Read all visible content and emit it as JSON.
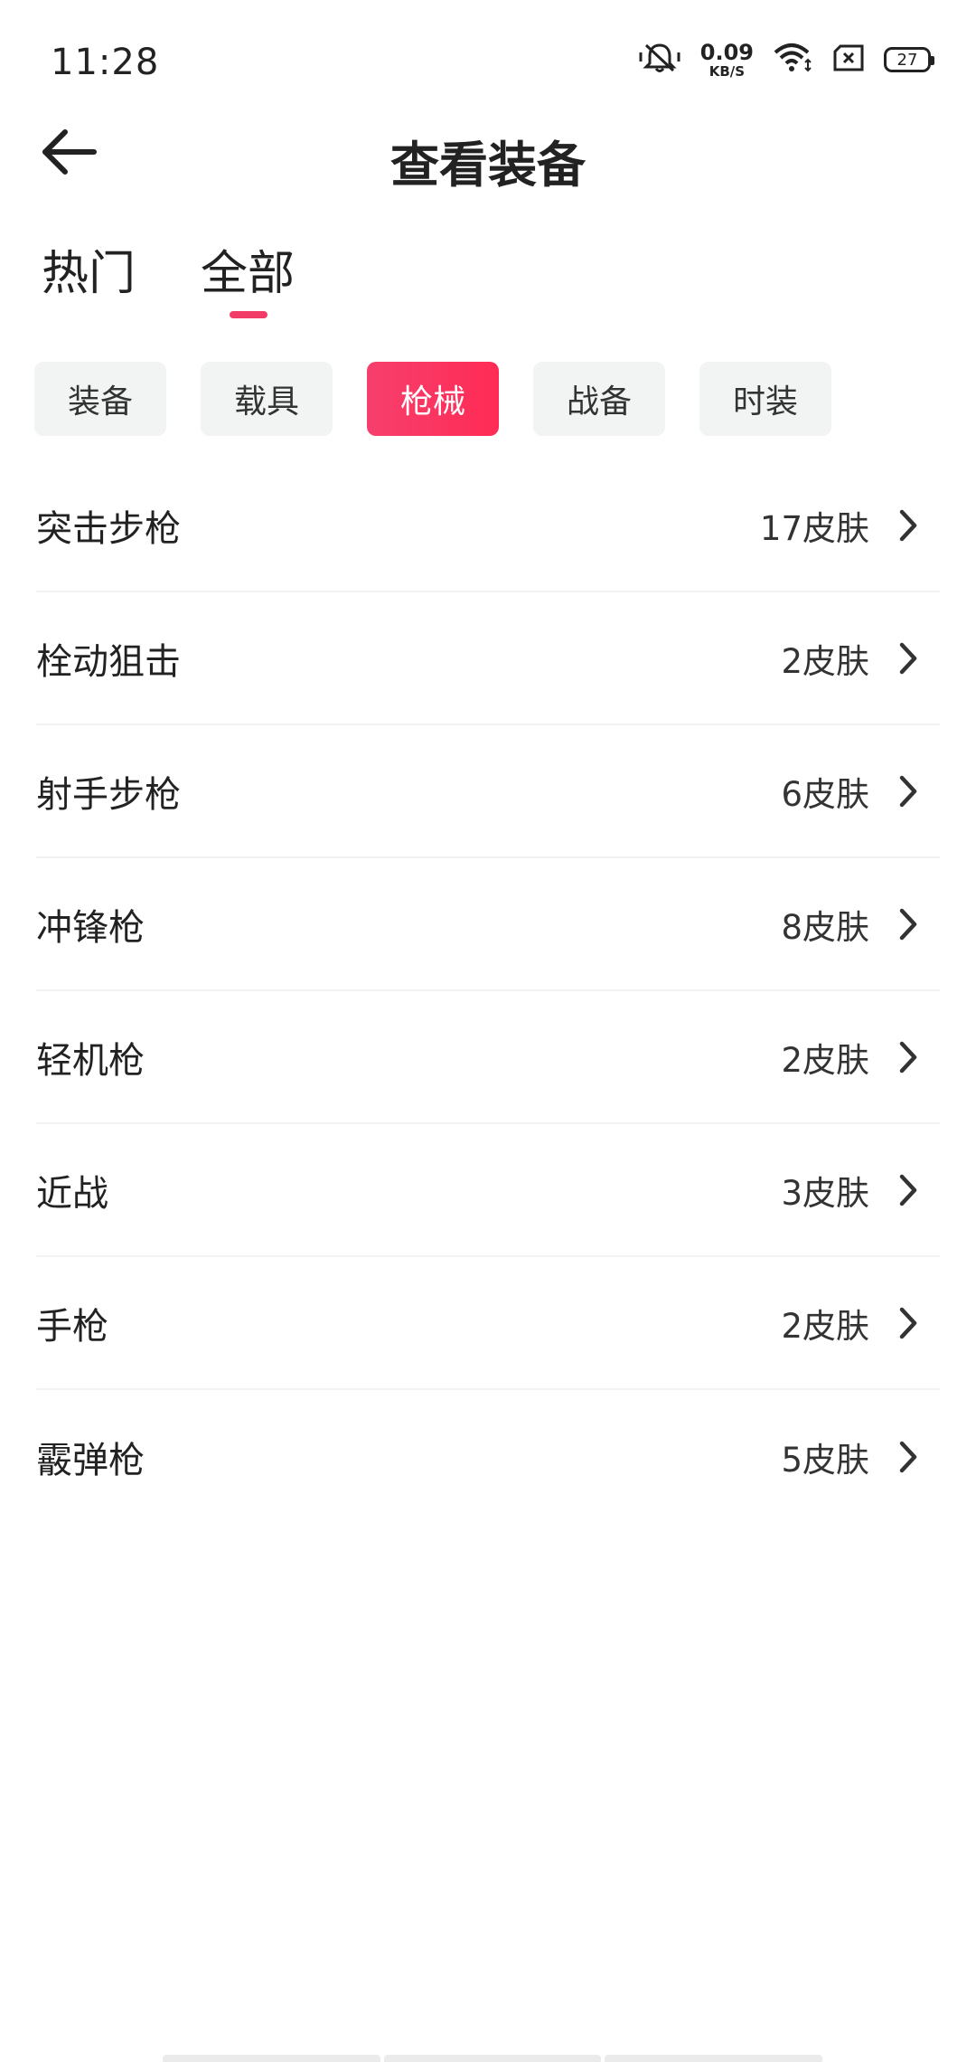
{
  "status_bar": {
    "time": "11:28",
    "net_speed_value": "0.09",
    "net_speed_unit": "KB/S",
    "battery": "27",
    "icons": [
      "mute-bell-icon",
      "wifi-icon",
      "sim-x-icon",
      "battery-icon"
    ]
  },
  "header": {
    "title": "查看装备",
    "back_icon": "arrow-left-icon"
  },
  "top_tabs": {
    "items": [
      {
        "label": "热门",
        "active": false
      },
      {
        "label": "全部",
        "active": true
      }
    ],
    "accent_color": "#f23c68"
  },
  "chips": {
    "items": [
      {
        "label": "装备",
        "active": false
      },
      {
        "label": "载具",
        "active": false
      },
      {
        "label": "枪械",
        "active": true
      },
      {
        "label": "战备",
        "active": false
      },
      {
        "label": "时装",
        "active": false
      }
    ],
    "active_color": "#ff2b55",
    "inactive_color": "#f1f4f3"
  },
  "list": {
    "items": [
      {
        "name": "突击步枪",
        "count": "17皮肤"
      },
      {
        "name": "栓动狙击",
        "count": "2皮肤"
      },
      {
        "name": "射手步枪",
        "count": "6皮肤"
      },
      {
        "name": "冲锋枪",
        "count": "8皮肤"
      },
      {
        "name": "轻机枪",
        "count": "2皮肤"
      },
      {
        "name": "近战",
        "count": "3皮肤"
      },
      {
        "name": "手枪",
        "count": "2皮肤"
      },
      {
        "name": "霰弹枪",
        "count": "5皮肤"
      }
    ],
    "chevron_icon": "chevron-right-icon"
  }
}
